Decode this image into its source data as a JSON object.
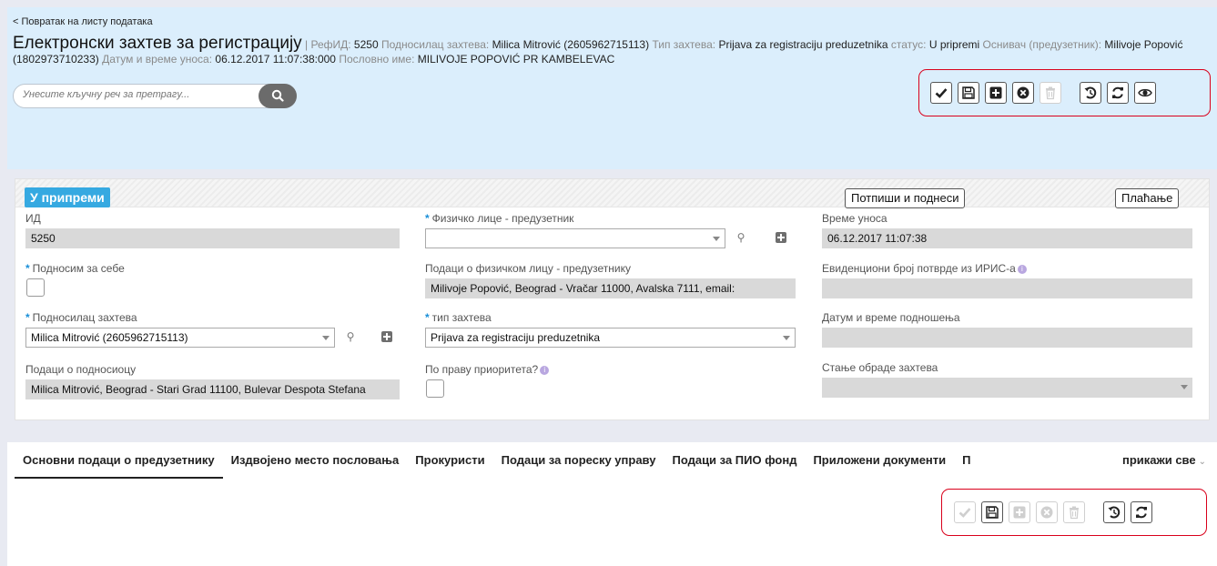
{
  "header": {
    "back_link": "< Повратак на листу података",
    "title": "Електронски захтев за регистрацију",
    "separator": " | ",
    "ref_id_label": "РефИД:",
    "ref_id_value": "5250",
    "applicant_label": "Подносилац захтева:",
    "applicant_value": "Milica Mitrović (2605962715113)",
    "request_type_label": "Тип захтева:",
    "request_type_value": "Prijava za registraciju preduzetnika",
    "status_label": "статус:",
    "status_value": "U pripremi",
    "founder_label": "Оснивач (предузетник):",
    "founder_value": "Milivoje Popović (1802973710233)",
    "entry_label": "Датум и време уноса:",
    "entry_value": "06.12.2017 11:07:38:000",
    "business_name_label": "Пословно име:",
    "business_name_value": "MILIVOJE POPOVIĆ PR KAMBELEVAC"
  },
  "search": {
    "placeholder": "Унесите кључну реч за претрагу..."
  },
  "top_toolbar": {
    "buttons": [
      {
        "icon": "check-icon",
        "enabled": true
      },
      {
        "icon": "save-icon",
        "enabled": true
      },
      {
        "icon": "add-icon",
        "enabled": true
      },
      {
        "icon": "cancel-icon",
        "enabled": true
      },
      {
        "icon": "trash-icon",
        "enabled": false
      },
      {
        "icon": "undo-icon",
        "enabled": true
      },
      {
        "icon": "refresh-icon",
        "enabled": true
      },
      {
        "icon": "eye-icon",
        "enabled": true
      }
    ]
  },
  "card": {
    "status_badge": "У припреми",
    "sign_submit_label": "Потпиши и поднеси",
    "payment_label": "Плаћање",
    "fields": {
      "id_label": "ИД",
      "id_value": "5250",
      "submit_self_label": "Подносим за себе",
      "applicant_label": "Подносилац захтева",
      "applicant_value": "Milica Mitrović (2605962715113)",
      "applicant_data_label": "Подаци о подносиоцу",
      "applicant_data_value": "Milica Mitrović, Beograd - Stari Grad 11100, Bulevar Despota Stefana",
      "person_label": "Физичко лице - предузетник",
      "person_value": "",
      "person_data_label": "Подаци о физичком лицу - предузетнику",
      "person_data_value": "Milivoje Popović, Beograd - Vračar 11000, Avalska 7111, email:",
      "request_type_label": "тип захтева",
      "request_type_value": "Prijava za registraciju preduzetnika",
      "priority_label": "По праву приоритета?",
      "entry_time_label": "Време уноса",
      "entry_time_value": "06.12.2017 11:07:38",
      "iris_label": "Евиденциони број потврде из ИРИС-а",
      "iris_value": "",
      "submission_label": "Датум и време подношења",
      "submission_value": "",
      "processing_state_label": "Стање обраде захтева",
      "processing_state_value": ""
    }
  },
  "tabs": {
    "items": [
      "Основни подаци о предузетнику",
      "Издвојено место пословања",
      "Прокуристи",
      "Подаци за пореску управу",
      "Подаци за ПИО фонд",
      "Приложени документи",
      "П"
    ],
    "active_index": 0,
    "show_all": "прикажи све"
  },
  "bottom_toolbar": {
    "buttons": [
      {
        "icon": "check-icon",
        "enabled": false
      },
      {
        "icon": "save-icon",
        "enabled": true
      },
      {
        "icon": "add-icon",
        "enabled": false
      },
      {
        "icon": "cancel-icon",
        "enabled": false
      },
      {
        "icon": "trash-icon",
        "enabled": false
      },
      {
        "icon": "undo-icon",
        "enabled": true
      },
      {
        "icon": "refresh-icon",
        "enabled": true
      }
    ]
  },
  "colors": {
    "top_background": "#dbeefc",
    "status_badge": "#36a9e1",
    "highlight_box": "#d9001b",
    "required_marker": "#1a8fd8"
  }
}
